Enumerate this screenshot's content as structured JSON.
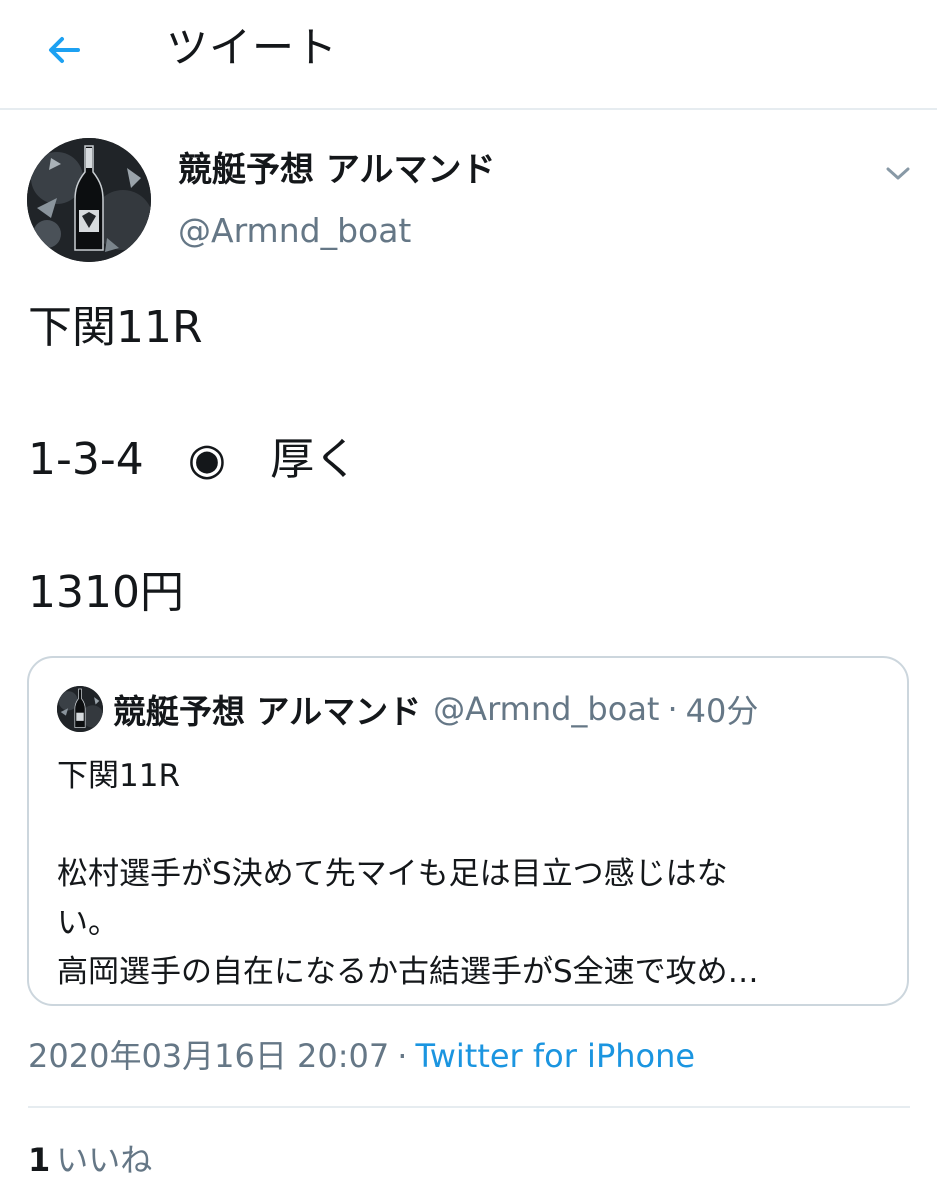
{
  "header": {
    "title": "ツイート",
    "back_icon": "arrow-left-icon",
    "accent_color": "#1da1f2"
  },
  "tweet": {
    "author": {
      "name": "競艇予想 アルマンド",
      "handle": "@Armnd_boat"
    },
    "menu_icon": "chevron-down-icon",
    "lines": [
      "下関11R",
      "1-3-4　◉　厚く",
      "1310円"
    ],
    "timestamp": "2020年03月16日 20:07",
    "separator": "·",
    "source": "Twitter for iPhone",
    "likes": {
      "count": "1",
      "label": "いいね"
    }
  },
  "quoted_tweet": {
    "name": "競艇予想 アルマンド",
    "handle": "@Armnd_boat",
    "separator": "·",
    "time": "40分",
    "text": "下関11R\n\n松村選手がS決めて先マイも足は目立つ感じはな\nい。\n高岡選手の自在になるか古結選手がS全速で攻め…"
  },
  "colors": {
    "text": "#14171a",
    "secondary": "#657786",
    "link": "#1b95e0",
    "border": "#ccd6dd",
    "divider": "#e6ecf0"
  }
}
